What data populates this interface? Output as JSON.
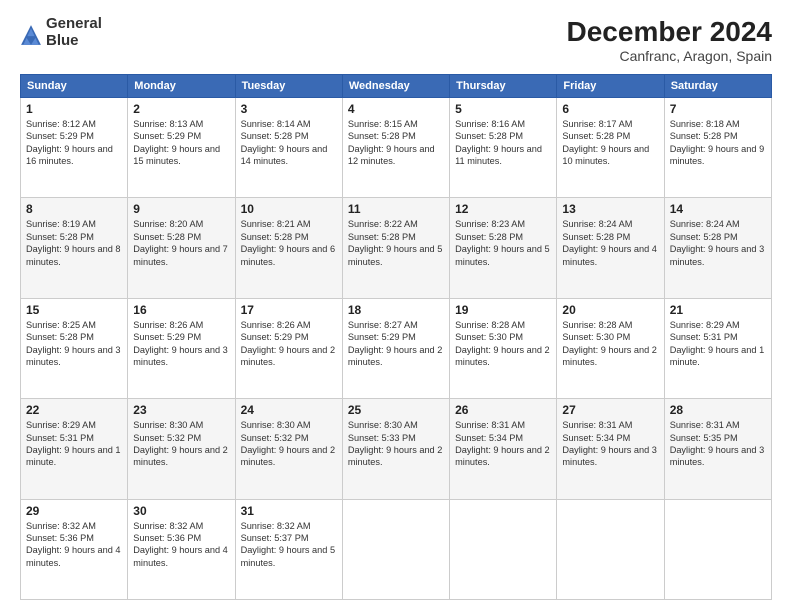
{
  "logo": {
    "line1": "General",
    "line2": "Blue"
  },
  "title": "December 2024",
  "subtitle": "Canfranc, Aragon, Spain",
  "headers": [
    "Sunday",
    "Monday",
    "Tuesday",
    "Wednesday",
    "Thursday",
    "Friday",
    "Saturday"
  ],
  "weeks": [
    [
      {
        "day": "1",
        "info": "Sunrise: 8:12 AM\nSunset: 5:29 PM\nDaylight: 9 hours and 16 minutes."
      },
      {
        "day": "2",
        "info": "Sunrise: 8:13 AM\nSunset: 5:29 PM\nDaylight: 9 hours and 15 minutes."
      },
      {
        "day": "3",
        "info": "Sunrise: 8:14 AM\nSunset: 5:28 PM\nDaylight: 9 hours and 14 minutes."
      },
      {
        "day": "4",
        "info": "Sunrise: 8:15 AM\nSunset: 5:28 PM\nDaylight: 9 hours and 12 minutes."
      },
      {
        "day": "5",
        "info": "Sunrise: 8:16 AM\nSunset: 5:28 PM\nDaylight: 9 hours and 11 minutes."
      },
      {
        "day": "6",
        "info": "Sunrise: 8:17 AM\nSunset: 5:28 PM\nDaylight: 9 hours and 10 minutes."
      },
      {
        "day": "7",
        "info": "Sunrise: 8:18 AM\nSunset: 5:28 PM\nDaylight: 9 hours and 9 minutes."
      }
    ],
    [
      {
        "day": "8",
        "info": "Sunrise: 8:19 AM\nSunset: 5:28 PM\nDaylight: 9 hours and 8 minutes."
      },
      {
        "day": "9",
        "info": "Sunrise: 8:20 AM\nSunset: 5:28 PM\nDaylight: 9 hours and 7 minutes."
      },
      {
        "day": "10",
        "info": "Sunrise: 8:21 AM\nSunset: 5:28 PM\nDaylight: 9 hours and 6 minutes."
      },
      {
        "day": "11",
        "info": "Sunrise: 8:22 AM\nSunset: 5:28 PM\nDaylight: 9 hours and 5 minutes."
      },
      {
        "day": "12",
        "info": "Sunrise: 8:23 AM\nSunset: 5:28 PM\nDaylight: 9 hours and 5 minutes."
      },
      {
        "day": "13",
        "info": "Sunrise: 8:24 AM\nSunset: 5:28 PM\nDaylight: 9 hours and 4 minutes."
      },
      {
        "day": "14",
        "info": "Sunrise: 8:24 AM\nSunset: 5:28 PM\nDaylight: 9 hours and 3 minutes."
      }
    ],
    [
      {
        "day": "15",
        "info": "Sunrise: 8:25 AM\nSunset: 5:28 PM\nDaylight: 9 hours and 3 minutes."
      },
      {
        "day": "16",
        "info": "Sunrise: 8:26 AM\nSunset: 5:29 PM\nDaylight: 9 hours and 3 minutes."
      },
      {
        "day": "17",
        "info": "Sunrise: 8:26 AM\nSunset: 5:29 PM\nDaylight: 9 hours and 2 minutes."
      },
      {
        "day": "18",
        "info": "Sunrise: 8:27 AM\nSunset: 5:29 PM\nDaylight: 9 hours and 2 minutes."
      },
      {
        "day": "19",
        "info": "Sunrise: 8:28 AM\nSunset: 5:30 PM\nDaylight: 9 hours and 2 minutes."
      },
      {
        "day": "20",
        "info": "Sunrise: 8:28 AM\nSunset: 5:30 PM\nDaylight: 9 hours and 2 minutes."
      },
      {
        "day": "21",
        "info": "Sunrise: 8:29 AM\nSunset: 5:31 PM\nDaylight: 9 hours and 1 minute."
      }
    ],
    [
      {
        "day": "22",
        "info": "Sunrise: 8:29 AM\nSunset: 5:31 PM\nDaylight: 9 hours and 1 minute."
      },
      {
        "day": "23",
        "info": "Sunrise: 8:30 AM\nSunset: 5:32 PM\nDaylight: 9 hours and 2 minutes."
      },
      {
        "day": "24",
        "info": "Sunrise: 8:30 AM\nSunset: 5:32 PM\nDaylight: 9 hours and 2 minutes."
      },
      {
        "day": "25",
        "info": "Sunrise: 8:30 AM\nSunset: 5:33 PM\nDaylight: 9 hours and 2 minutes."
      },
      {
        "day": "26",
        "info": "Sunrise: 8:31 AM\nSunset: 5:34 PM\nDaylight: 9 hours and 2 minutes."
      },
      {
        "day": "27",
        "info": "Sunrise: 8:31 AM\nSunset: 5:34 PM\nDaylight: 9 hours and 3 minutes."
      },
      {
        "day": "28",
        "info": "Sunrise: 8:31 AM\nSunset: 5:35 PM\nDaylight: 9 hours and 3 minutes."
      }
    ],
    [
      {
        "day": "29",
        "info": "Sunrise: 8:32 AM\nSunset: 5:36 PM\nDaylight: 9 hours and 4 minutes."
      },
      {
        "day": "30",
        "info": "Sunrise: 8:32 AM\nSunset: 5:36 PM\nDaylight: 9 hours and 4 minutes."
      },
      {
        "day": "31",
        "info": "Sunrise: 8:32 AM\nSunset: 5:37 PM\nDaylight: 9 hours and 5 minutes."
      },
      null,
      null,
      null,
      null
    ]
  ]
}
